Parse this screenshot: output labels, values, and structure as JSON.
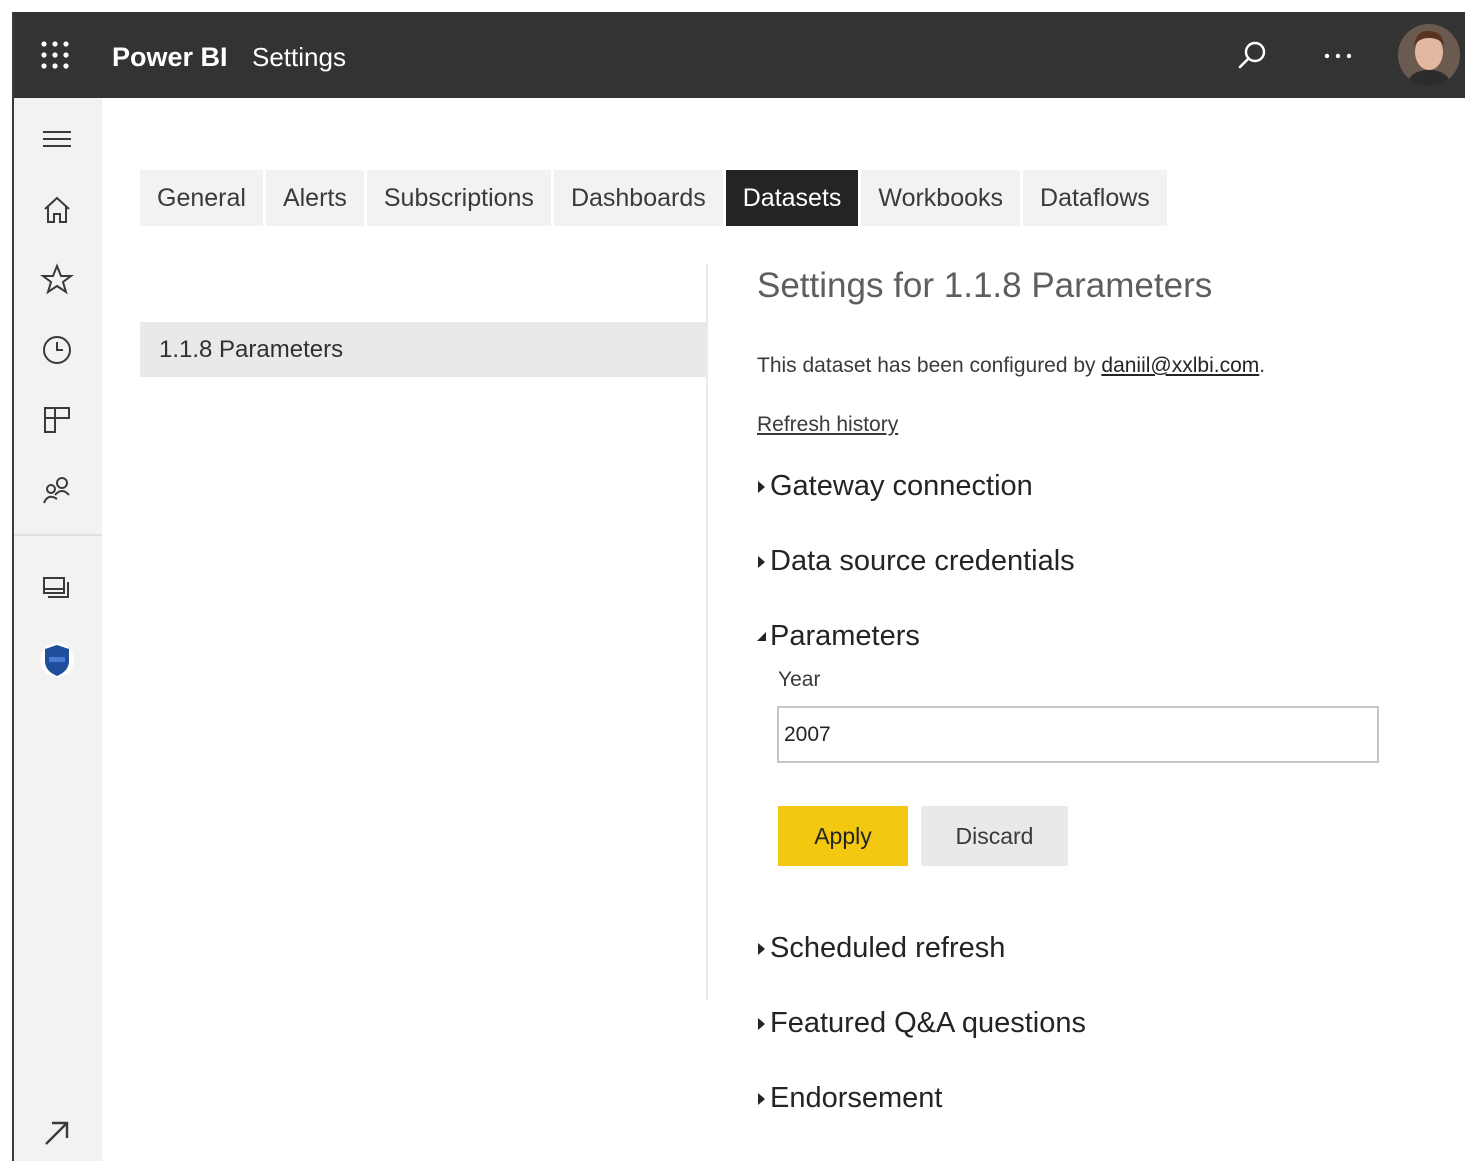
{
  "header": {
    "app_name": "Power BI",
    "breadcrumb": "Settings",
    "bg_color": "#333333"
  },
  "leftnav": {
    "items": [
      {
        "icon": "hamburger-icon"
      },
      {
        "icon": "home-icon"
      },
      {
        "icon": "star-icon"
      },
      {
        "icon": "clock-icon"
      },
      {
        "icon": "apps-icon"
      },
      {
        "icon": "shared-icon"
      },
      {
        "icon": "workspaces-icon"
      },
      {
        "icon": "shield-workspace-icon"
      },
      {
        "icon": "expand-arrow-icon"
      }
    ]
  },
  "tabs": [
    "General",
    "Alerts",
    "Subscriptions",
    "Dashboards",
    "Datasets",
    "Workbooks",
    "Dataflows"
  ],
  "active_tab": "Datasets",
  "datasets": {
    "selected": "1.1.8 Parameters"
  },
  "panel": {
    "title": "Settings for 1.1.8 Parameters",
    "config_prefix": "This dataset has been configured by ",
    "config_email": "daniil@xxlbi.com",
    "config_suffix": ".",
    "refresh_history": "Refresh history",
    "sections": {
      "gateway": "Gateway connection",
      "credentials": "Data source credentials",
      "parameters": "Parameters",
      "scheduled": "Scheduled refresh",
      "qna": "Featured Q&A questions",
      "endorsement": "Endorsement"
    },
    "parameter": {
      "label": "Year",
      "value": "2007"
    },
    "apply_label": "Apply",
    "discard_label": "Discard",
    "accent_color": "#f2c811"
  }
}
